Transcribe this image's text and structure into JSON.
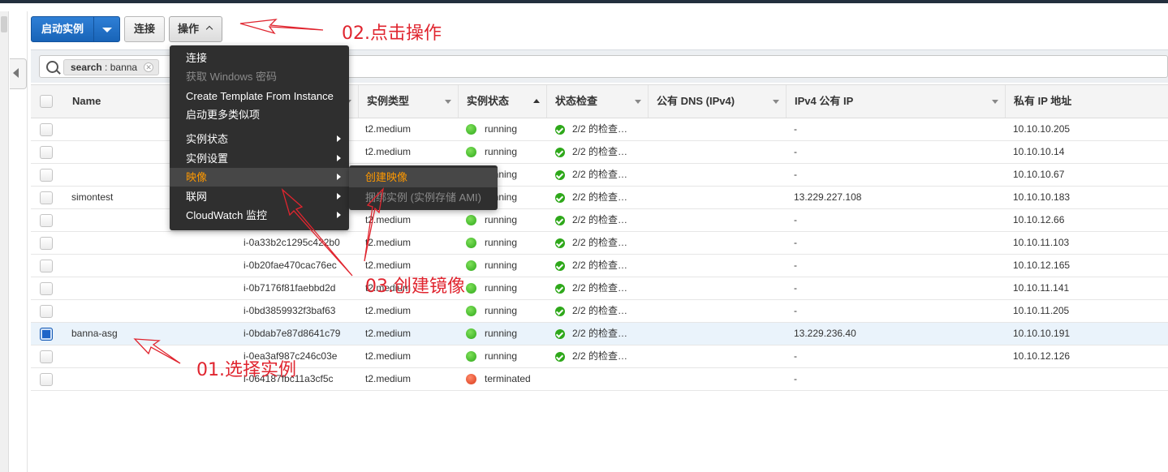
{
  "toolbar": {
    "launch_label": "启动实例",
    "connect_label": "连接",
    "actions_label": "操作"
  },
  "search": {
    "token_key": "search",
    "token_sep": " : ",
    "token_value": "banna"
  },
  "table": {
    "headers": {
      "name": "Name",
      "instance_type": "实例类型",
      "instance_state": "实例状态",
      "status_check": "状态检查",
      "public_dns": "公有 DNS (IPv4)",
      "ipv4_public": "IPv4 公有 IP",
      "private_ip": "私有 IP 地址"
    },
    "rows": [
      {
        "name": "",
        "instance_id": "",
        "type": "t2.medium",
        "state": "running",
        "check": "2/2 的检查…",
        "ipv4": "-",
        "private_ip": "10.10.10.205"
      },
      {
        "name": "",
        "instance_id": "",
        "type": "t2.medium",
        "state": "running",
        "check": "2/2 的检查…",
        "ipv4": "-",
        "private_ip": "10.10.10.14"
      },
      {
        "name": "",
        "instance_id": "",
        "type": "t2.medium",
        "state": "running",
        "check": "2/2 的检查…",
        "ipv4": "-",
        "private_ip": "10.10.10.67"
      },
      {
        "name": "simontest",
        "instance_id": "",
        "type": "t2.medium",
        "state": "running",
        "check": "2/2 的检查…",
        "ipv4": "13.229.227.108",
        "private_ip": "10.10.10.183"
      },
      {
        "name": "",
        "instance_id": "",
        "type": "t2.medium",
        "state": "running",
        "check": "2/2 的检查…",
        "ipv4": "-",
        "private_ip": "10.10.12.66"
      },
      {
        "name": "",
        "instance_id": "i-0a33b2c1295c422b0",
        "type": "t2.medium",
        "state": "running",
        "check": "2/2 的检查…",
        "ipv4": "-",
        "private_ip": "10.10.11.103"
      },
      {
        "name": "",
        "instance_id": "i-0b20fae470cac76ec",
        "type": "t2.medium",
        "state": "running",
        "check": "2/2 的检查…",
        "ipv4": "-",
        "private_ip": "10.10.12.165"
      },
      {
        "name": "",
        "instance_id": "i-0b7176f81faebbd2d",
        "type": "t2.medium",
        "state": "running",
        "check": "2/2 的检查…",
        "ipv4": "-",
        "private_ip": "10.10.11.141"
      },
      {
        "name": "",
        "instance_id": "i-0bd3859932f3baf63",
        "type": "t2.medium",
        "state": "running",
        "check": "2/2 的检查…",
        "ipv4": "-",
        "private_ip": "10.10.11.205"
      },
      {
        "name": "banna-asg",
        "instance_id": "i-0bdab7e87d8641c79",
        "type": "t2.medium",
        "state": "running",
        "check": "2/2 的检查…",
        "ipv4": "13.229.236.40",
        "private_ip": "10.10.10.191",
        "selected": true
      },
      {
        "name": "",
        "instance_id": "i-0ea3af987c246c03e",
        "type": "t2.medium",
        "state": "running",
        "check": "2/2 的检查…",
        "ipv4": "-",
        "private_ip": "10.10.12.126"
      },
      {
        "name": "",
        "instance_id": "i-064187fbc11a3cf5c",
        "type": "t2.medium",
        "state": "terminated",
        "check": "",
        "ipv4": "-",
        "private_ip": ""
      }
    ]
  },
  "actions_menu": {
    "items": [
      {
        "label": "连接",
        "disabled": false
      },
      {
        "label": "获取 Windows 密码",
        "disabled": true
      },
      {
        "label": "Create Template From Instance",
        "disabled": false
      },
      {
        "label": "启动更多类似项",
        "disabled": false
      },
      {
        "label": "实例状态",
        "submenu": true
      },
      {
        "label": "实例设置",
        "submenu": true
      },
      {
        "label": "映像",
        "submenu": true,
        "active": true
      },
      {
        "label": "联网",
        "submenu": true
      },
      {
        "label": "CloudWatch 监控",
        "submenu": true
      }
    ],
    "image_submenu": [
      {
        "label": "创建映像",
        "active": true
      },
      {
        "label": "捆绑实例 (实例存储 AMI)",
        "disabled": true
      }
    ]
  },
  "annotations": {
    "step1": "01.选择实例",
    "step2": "02.点击操作",
    "step3": "03.创建镜像"
  },
  "colors": {
    "primary_button": "#1864b8",
    "menu_bg": "#2f2f2f",
    "menu_active_text": "#ff9900",
    "running": "#2ea81a",
    "terminated": "#d9391a",
    "annotation": "#e0252f"
  }
}
